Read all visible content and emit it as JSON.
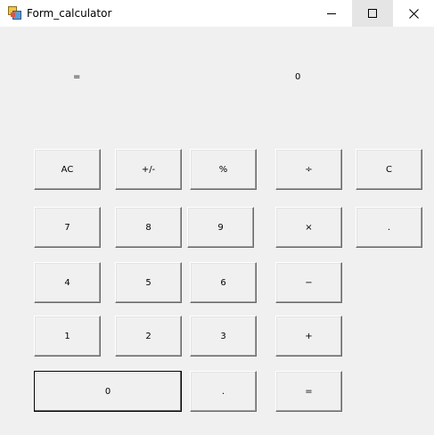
{
  "window": {
    "title": "Form_calculator",
    "controls": {
      "minimize": "minimize",
      "maximize": "maximize",
      "close": "close"
    }
  },
  "display": {
    "operator": "=",
    "value": "0"
  },
  "keys": {
    "ac": "AC",
    "sign": "+/-",
    "percent": "%",
    "divide": "÷",
    "clear": "C",
    "n7": "7",
    "n8": "8",
    "n9": "9",
    "multiply": "×",
    "dot_right": ".",
    "n4": "4",
    "n5": "5",
    "n6": "6",
    "minus": "−",
    "n1": "1",
    "n2": "2",
    "n3": "3",
    "plus": "+",
    "n0": "0",
    "dot": ".",
    "equals": "="
  }
}
